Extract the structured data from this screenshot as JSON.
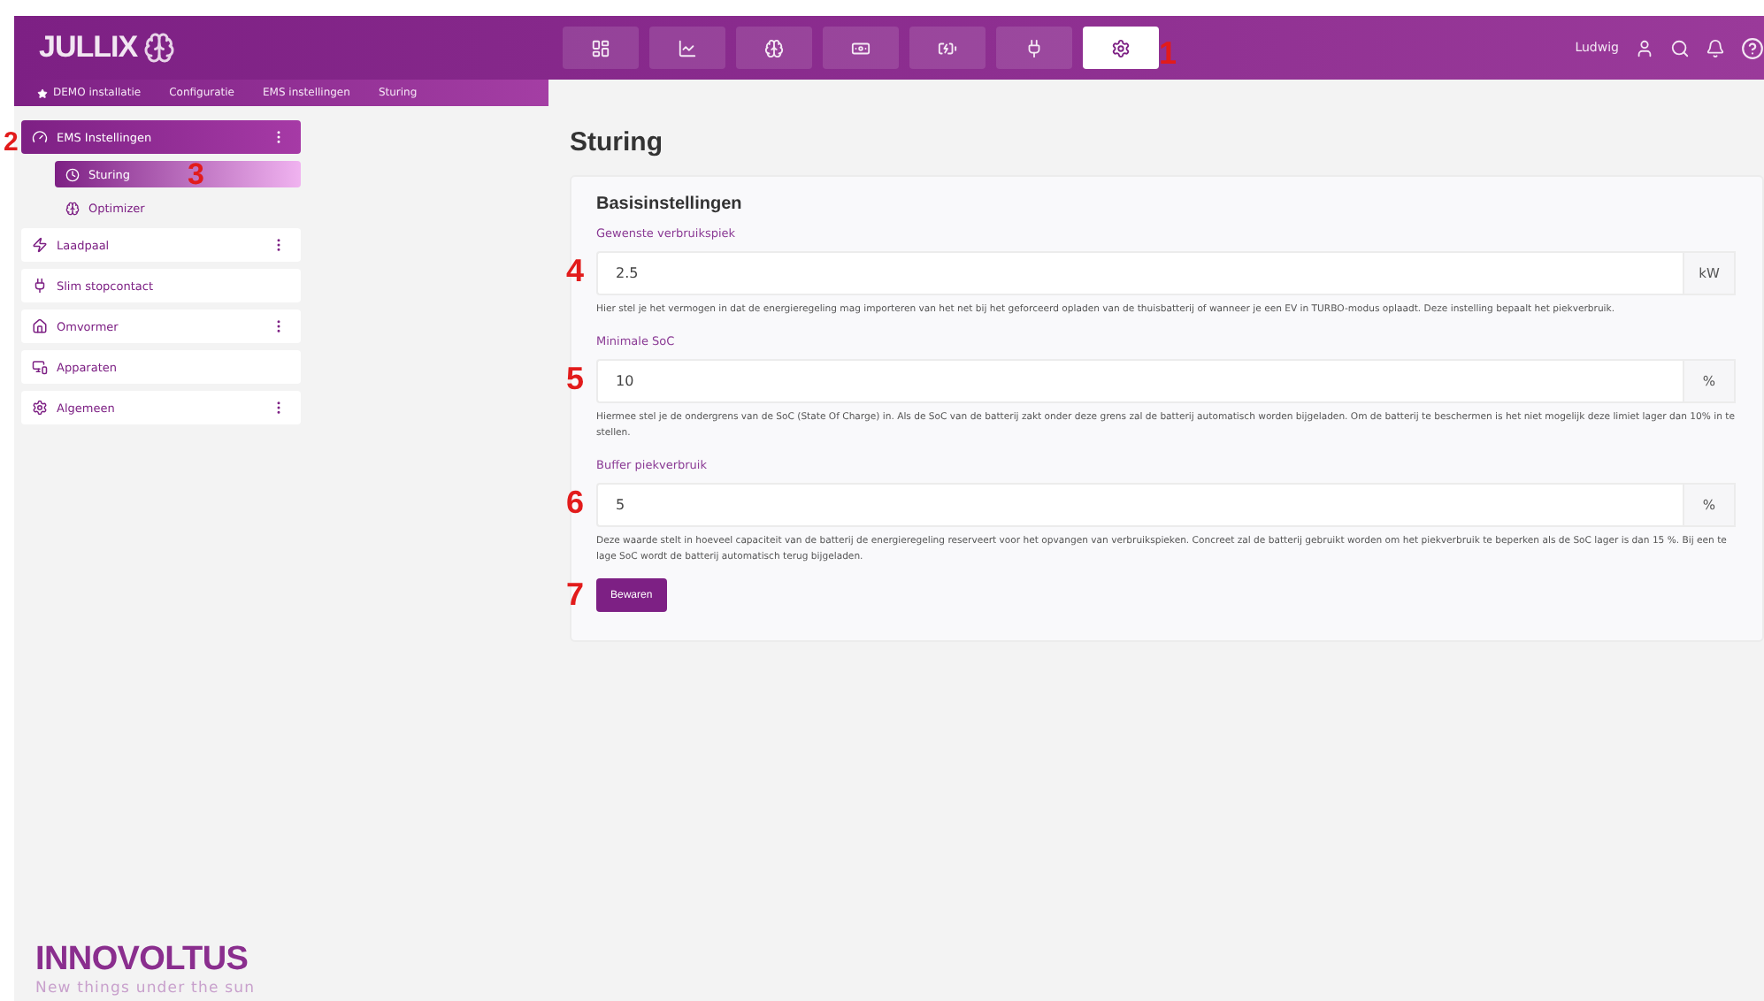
{
  "header": {
    "logo": "JULLIX",
    "nav": [
      {
        "selected": false
      },
      {
        "selected": false
      },
      {
        "selected": false
      },
      {
        "selected": false
      },
      {
        "selected": false
      },
      {
        "selected": false
      },
      {
        "selected": true,
        "annotation": "1"
      }
    ],
    "user": "Ludwig"
  },
  "breadcrumb": [
    "DEMO installatie",
    "Configuratie",
    "EMS instellingen",
    "Sturing"
  ],
  "sidebar": {
    "items": [
      {
        "label": "EMS Instellingen",
        "selected": true,
        "menu": true,
        "annotation": "2",
        "children": [
          {
            "label": "Sturing",
            "selected": true,
            "annotation": "3"
          },
          {
            "label": "Optimizer",
            "selected": false
          }
        ]
      },
      {
        "label": "Laadpaal",
        "selected": false,
        "menu": true
      },
      {
        "label": "Slim stopcontact",
        "selected": false,
        "menu": false
      },
      {
        "label": "Omvormer",
        "selected": false,
        "menu": true
      },
      {
        "label": "Apparaten",
        "selected": false,
        "menu": false
      },
      {
        "label": "Algemeen",
        "selected": false,
        "menu": true
      }
    ]
  },
  "page": {
    "title": "Sturing",
    "card": {
      "title": "Basisinstellingen",
      "fields": [
        {
          "label": "Gewenste verbruikspiek",
          "value": "2.5",
          "unit": "kW",
          "annotation": "4",
          "help": "Hier stel je het vermogen in dat de energieregeling mag importeren van het net bij het geforceerd opladen van de thuisbatterij of wanneer je een EV in TURBO-modus oplaadt. Deze instelling bepaalt het piekverbruik."
        },
        {
          "label": "Minimale SoC",
          "value": "10",
          "unit": "%",
          "annotation": "5",
          "help": "Hiermee stel je de ondergrens van de SoC (State Of Charge) in. Als de SoC van de batterij zakt onder deze grens zal de batterij automatisch worden bijgeladen. Om de batterij te beschermen is het niet mogelijk deze limiet lager dan 10% in te stellen."
        },
        {
          "label": "Buffer piekverbruik",
          "value": "5",
          "unit": "%",
          "annotation": "6",
          "help": "Deze waarde stelt in hoeveel capaciteit van de batterij de energieregeling reserveert voor het opvangen van verbruikspieken. Concreet zal de batterij gebruikt worden om het piekverbruik te beperken als de SoC lager is dan 15 %. Bij een te lage SoC wordt de batterij automatisch terug bijgeladen."
        }
      ],
      "button": {
        "label": "Bewaren",
        "annotation": "7"
      }
    }
  },
  "footer": {
    "brand": "INNOVOLTUS",
    "tagline": "New things under the sun"
  }
}
